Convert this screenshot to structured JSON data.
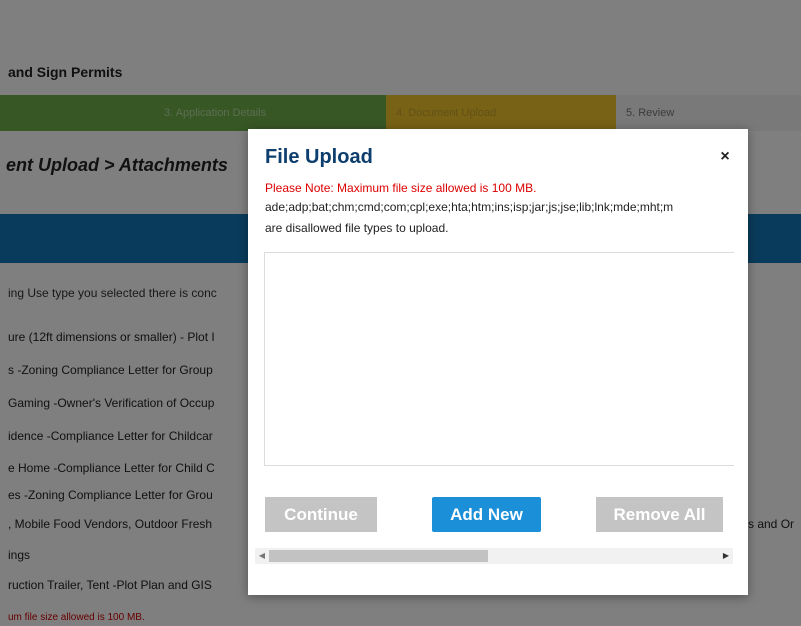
{
  "background": {
    "page_heading": "and Sign Permits",
    "steps": [
      {
        "label": "3. Application Details"
      },
      {
        "label": "4. Document Upload"
      },
      {
        "label": "5. Review"
      }
    ],
    "section_title": "ent Upload > Attachments",
    "lines": [
      "ing Use type you selected there is conc",
      "ure (12ft dimensions or smaller) - Plot I",
      "s -Zoning Compliance Letter for Group",
      "Gaming -Owner's Verification of Occup",
      "idence -Compliance Letter for Childcar",
      "e Home -Compliance Letter for Child C",
      "es -Zoning Compliance Letter for Grou",
      ", Mobile Food Vendors, Outdoor Fresh",
      "ings",
      "ruction Trailer, Tent -Plot Plan and GIS"
    ],
    "right_text": "s and Or",
    "footer_note": "um file size allowed is 100 MB."
  },
  "modal": {
    "title": "File Upload",
    "note": "Please Note: Maximum file size allowed is 100 MB.",
    "disallowed_types": "ade;adp;bat;chm;cmd;com;cpl;exe;hta;htm;ins;isp;jar;js;jse;lib;lnk;mde;mht;m",
    "disallowed_suffix": "are disallowed file types to upload.",
    "close_label": "×",
    "buttons": {
      "continue": "Continue",
      "add_new": "Add New",
      "remove_all": "Remove All"
    },
    "scroll_left": "◀",
    "scroll_right": "▶"
  },
  "colors": {
    "title_blue": "#0d3e6e",
    "note_red": "#dd0000",
    "add_button": "#1b8fd8",
    "disabled_button": "#c4c4c4",
    "banner_blue": "#1279b8"
  }
}
